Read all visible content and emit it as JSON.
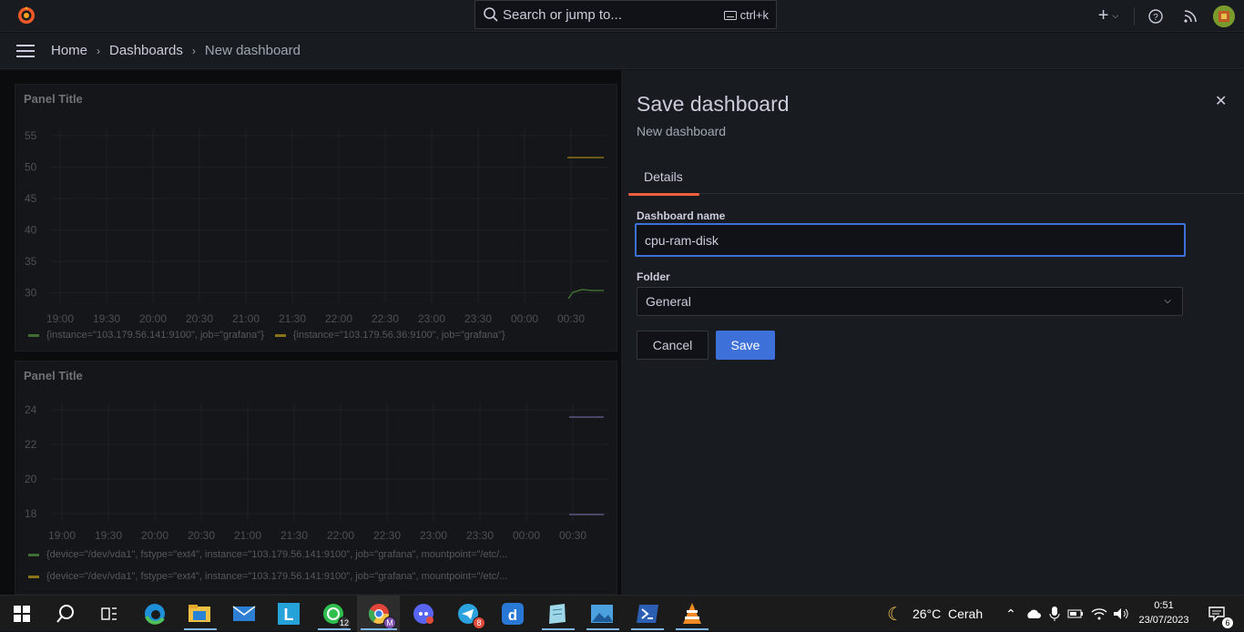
{
  "topbar": {
    "search_placeholder": "Search or jump to...",
    "search_shortcut": "ctrl+k",
    "add_icon": "plus-icon",
    "help_icon": "help-circle-icon",
    "news_icon": "rss-icon"
  },
  "breadcrumb": [
    "Home",
    "Dashboards",
    "New dashboard"
  ],
  "panels": [
    {
      "title": "Panel Title",
      "y_ticks": [
        "55",
        "50",
        "45",
        "40",
        "35",
        "30"
      ],
      "x_ticks": [
        "19:00",
        "19:30",
        "20:00",
        "20:30",
        "21:00",
        "21:30",
        "22:00",
        "22:30",
        "23:00",
        "23:30",
        "00:00",
        "00:30"
      ],
      "legend": [
        {
          "label": "{instance=\"103.179.56.141:9100\", job=\"grafana\"}",
          "color": "#4f8a3c"
        },
        {
          "label": "{instance=\"103.179.56.36:9100\", job=\"grafana\"}",
          "color": "#a88a1c"
        }
      ]
    },
    {
      "title": "Panel Title",
      "y_ticks": [
        "24",
        "22",
        "20",
        "18"
      ],
      "x_ticks": [
        "19:00",
        "19:30",
        "20:00",
        "20:30",
        "21:00",
        "21:30",
        "22:00",
        "22:30",
        "23:00",
        "23:30",
        "00:00",
        "00:30"
      ],
      "legend": [
        {
          "label": "{device=\"/dev/vda1\", fstype=\"ext4\", instance=\"103.179.56.141:9100\", job=\"grafana\", mountpoint=\"/etc/...",
          "color": "#4f8a3c"
        },
        {
          "label": "{device=\"/dev/vda1\", fstype=\"ext4\", instance=\"103.179.56.141:9100\", job=\"grafana\", mountpoint=\"/etc/...",
          "color": "#a88a1c"
        }
      ]
    }
  ],
  "drawer": {
    "title": "Save dashboard",
    "subtitle": "New dashboard",
    "close_icon": "close-icon",
    "tab": "Details",
    "name_label": "Dashboard name",
    "name_value": "cpu-ram-disk",
    "folder_label": "Folder",
    "folder_value": "General",
    "cancel": "Cancel",
    "save": "Save"
  },
  "taskbar": {
    "whatsapp_badge": "12",
    "chrome_badge": "M",
    "telegram_badge": "8",
    "weather": "26°C  Cerah",
    "time": "0:51",
    "date": "23/07/2023",
    "notifications": "6"
  },
  "colors": {
    "accent": "#3d71d9",
    "tab_underline": "#f55f3e",
    "series_green": "#4f8a3c",
    "series_yellow": "#a88a1c",
    "series_purple": "#6d6a9e"
  }
}
